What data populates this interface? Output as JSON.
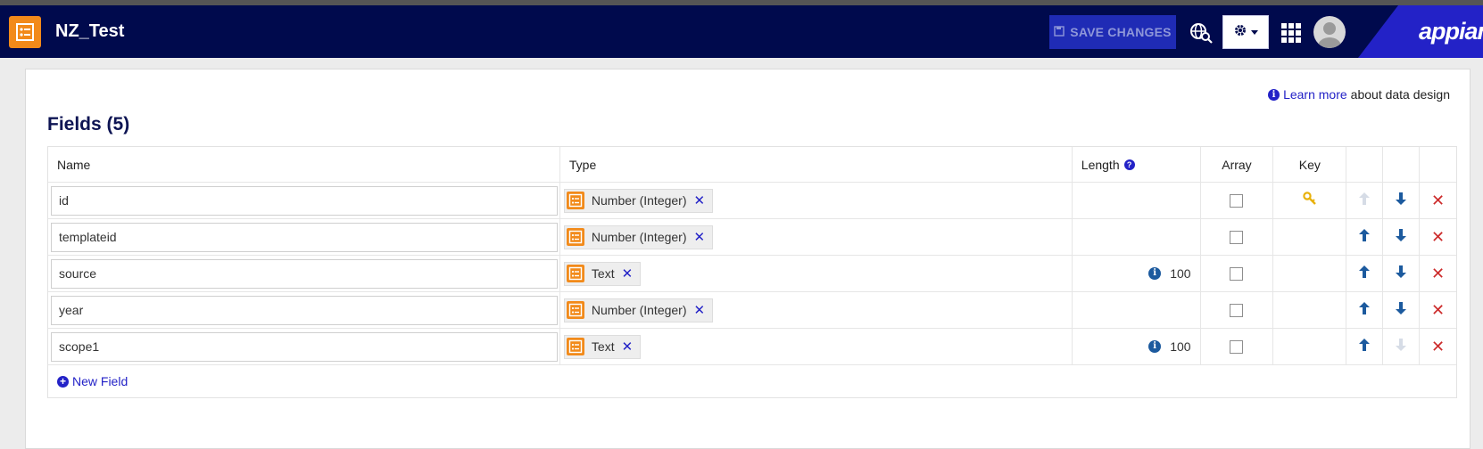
{
  "header": {
    "app_title": "NZ_Test",
    "save_label": "SAVE CHANGES",
    "brand": "appian",
    "icons": [
      "record-type-icon",
      "save-disk-icon",
      "globe-search-icon",
      "gear-icon",
      "chevron-down-icon",
      "apps-grid-icon",
      "avatar-icon"
    ],
    "colors": {
      "header_bg": "#000a4d",
      "save_bg": "#1f2bb5",
      "accent": "#2322c7",
      "app_icon": "#f28a1a"
    }
  },
  "learn": {
    "link": "Learn more",
    "suffix": "about data design"
  },
  "fields": {
    "title": "Fields (5)",
    "columns": {
      "name": "Name",
      "type": "Type",
      "length": "Length",
      "array": "Array",
      "key": "Key"
    },
    "rows": [
      {
        "name": "id",
        "type": "Number (Integer)",
        "length": "",
        "array": false,
        "key": true,
        "up_enabled": false,
        "down_enabled": true
      },
      {
        "name": "templateid",
        "type": "Number (Integer)",
        "length": "",
        "array": false,
        "key": false,
        "up_enabled": true,
        "down_enabled": true
      },
      {
        "name": "source",
        "type": "Text",
        "length": "100",
        "array": false,
        "key": false,
        "up_enabled": true,
        "down_enabled": true
      },
      {
        "name": "year",
        "type": "Number (Integer)",
        "length": "",
        "array": false,
        "key": false,
        "up_enabled": true,
        "down_enabled": true
      },
      {
        "name": "scope1",
        "type": "Text",
        "length": "100",
        "array": false,
        "key": false,
        "up_enabled": true,
        "down_enabled": false
      }
    ],
    "new_field_label": "New Field"
  }
}
